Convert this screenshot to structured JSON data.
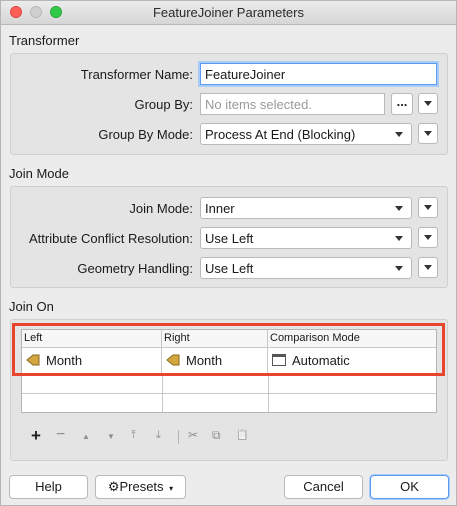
{
  "window": {
    "title": "FeatureJoiner Parameters"
  },
  "transformer": {
    "section_title": "Transformer",
    "name_label": "Transformer Name:",
    "name_value": "FeatureJoiner",
    "group_by_label": "Group By:",
    "group_by_placeholder": "No items selected.",
    "group_by_dots": "...",
    "group_by_mode_label": "Group By Mode:",
    "group_by_mode_value": "Process At End (Blocking)"
  },
  "join_mode": {
    "section_title": "Join Mode",
    "mode_label": "Join Mode:",
    "mode_value": "Inner",
    "conflict_label": "Attribute Conflict Resolution:",
    "conflict_value": "Use Left",
    "geometry_label": "Geometry Handling:",
    "geometry_value": "Use Left"
  },
  "join_on": {
    "section_title": "Join On",
    "columns": [
      "Left",
      "Right",
      "Comparison Mode"
    ],
    "rows": [
      {
        "left": "Month",
        "right": "Month",
        "mode": "Automatic"
      }
    ]
  },
  "toolbar": {
    "add": "+",
    "remove": "−",
    "up": "▲",
    "down": "▼",
    "top": "⤒",
    "bottom": "⤓",
    "cut": "✂",
    "copy": "⧉",
    "paste": "📋"
  },
  "footer": {
    "help_label": "Help",
    "presets_label": "Presets",
    "cancel_label": "Cancel",
    "ok_label": "OK"
  },
  "colors": {
    "highlight": "#e8452c",
    "attribute_icon": "#d4a640",
    "focus": "#5b9cf2"
  }
}
